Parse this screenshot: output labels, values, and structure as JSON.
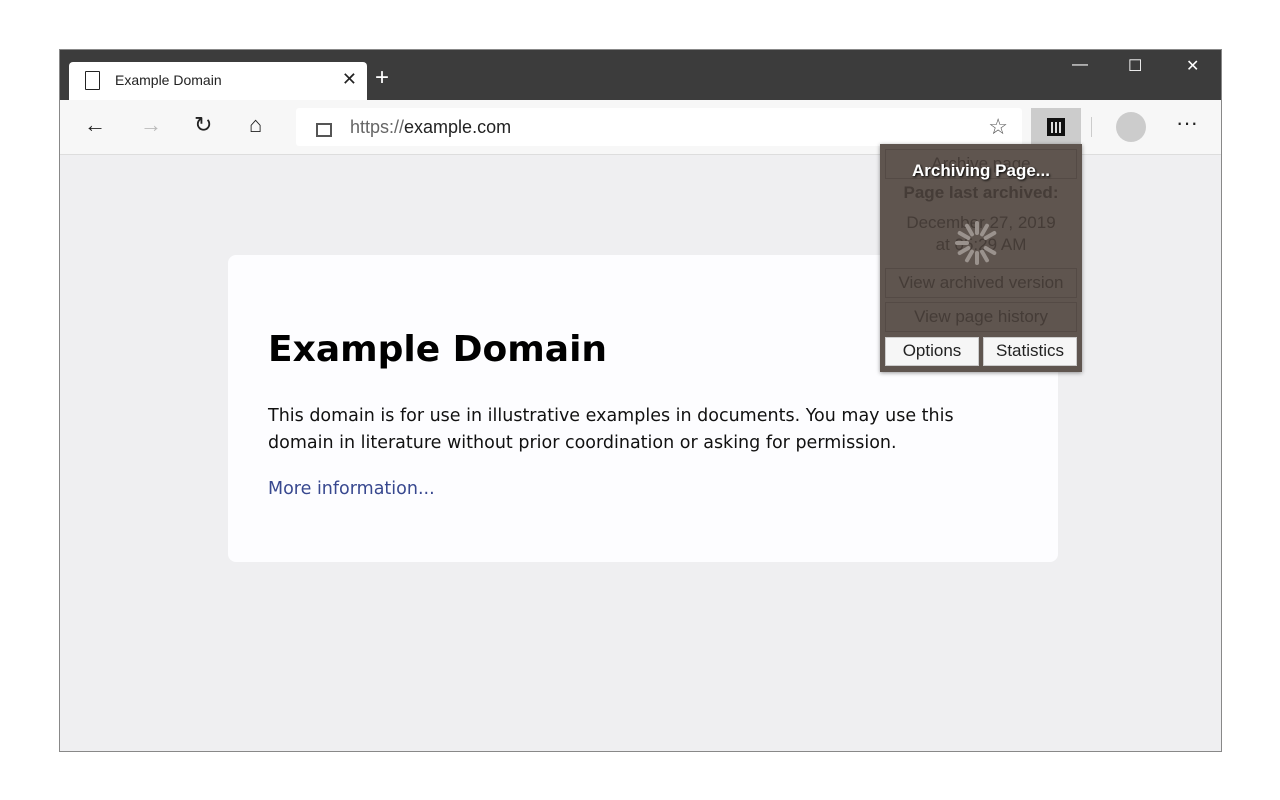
{
  "tab": {
    "title": "Example Domain",
    "close": "✕",
    "new": "+"
  },
  "window": {
    "minimize": "—",
    "maximize": "☐",
    "close": "✕"
  },
  "toolbar": {
    "back": "←",
    "forward": "→",
    "refresh": "↻",
    "home": "⌂",
    "url_scheme": "https://",
    "url_host": "example.com",
    "favorite": "☆",
    "more": "···"
  },
  "page": {
    "heading": "Example Domain",
    "body": "This domain is for use in illustrative examples in documents. You may use this domain in literature without prior coordination or asking for permission.",
    "link": "More information..."
  },
  "popup": {
    "status": "Archiving Page...",
    "archive_page": "Archive page",
    "last_archived_label": "Page last archived:",
    "last_archived_date": "December 27, 2019",
    "last_archived_time": "at 05:29 AM",
    "view_archived": "View archived version",
    "view_history": "View page history",
    "options": "Options",
    "statistics": "Statistics"
  }
}
